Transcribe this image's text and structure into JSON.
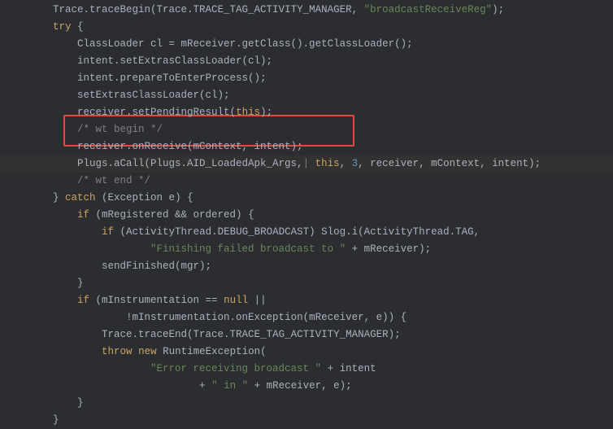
{
  "code": {
    "lines": [
      {
        "indent": "      ",
        "tokens": [
          {
            "t": "Trace.traceBegin(Trace.TRACE_TAG_ACTIVITY_MANAGER, ",
            "c": "ident"
          },
          {
            "t": "\"broadcastReceiveReg\"",
            "c": "str"
          },
          {
            "t": ");",
            "c": "punct"
          }
        ]
      },
      {
        "indent": "      ",
        "tokens": [
          {
            "t": "try",
            "c": "kw"
          },
          {
            "t": " {",
            "c": "punct"
          }
        ]
      },
      {
        "indent": "          ",
        "tokens": [
          {
            "t": "ClassLoader cl = mReceiver.getClass().getClassLoader();",
            "c": "ident"
          }
        ]
      },
      {
        "indent": "          ",
        "tokens": [
          {
            "t": "intent.setExtrasClassLoader(cl);",
            "c": "ident"
          }
        ]
      },
      {
        "indent": "          ",
        "tokens": [
          {
            "t": "intent.prepareToEnterProcess();",
            "c": "ident"
          }
        ]
      },
      {
        "indent": "          ",
        "tokens": [
          {
            "t": "setExtrasClassLoader(cl);",
            "c": "ident"
          }
        ]
      },
      {
        "indent": "          ",
        "tokens": [
          {
            "t": "receiver.setPendingResult(",
            "c": "ident"
          },
          {
            "t": "this",
            "c": "kw"
          },
          {
            "t": ");",
            "c": "punct"
          }
        ]
      },
      {
        "indent": "          ",
        "tokens": [
          {
            "t": "/* wt begin */",
            "c": "comment"
          }
        ]
      },
      {
        "indent": "          ",
        "tokens": [
          {
            "t": "receiver.onReceive(mContext, intent);",
            "c": "ident"
          }
        ]
      },
      {
        "indent": "          ",
        "tokens": [
          {
            "t": "Plugs.aCall(Plugs.AID_LoadedApk_Args,",
            "c": "ident"
          },
          {
            "t": "|",
            "c": "comment"
          },
          {
            "t": " ",
            "c": "ident"
          },
          {
            "t": "this",
            "c": "kw"
          },
          {
            "t": ", ",
            "c": "punct"
          },
          {
            "t": "3",
            "c": "num"
          },
          {
            "t": ", receiver, mContext, intent);",
            "c": "ident"
          }
        ]
      },
      {
        "indent": "          ",
        "tokens": [
          {
            "t": "/* wt end */",
            "c": "comment"
          }
        ]
      },
      {
        "indent": "      ",
        "tokens": [
          {
            "t": "} ",
            "c": "punct"
          },
          {
            "t": "catch",
            "c": "kw"
          },
          {
            "t": " (Exception e) {",
            "c": "ident"
          }
        ]
      },
      {
        "indent": "          ",
        "tokens": [
          {
            "t": "if",
            "c": "kw"
          },
          {
            "t": " (mRegistered && ordered) {",
            "c": "ident"
          }
        ]
      },
      {
        "indent": "              ",
        "tokens": [
          {
            "t": "if",
            "c": "kw"
          },
          {
            "t": " (ActivityThread.DEBUG_BROADCAST) Slog.i(ActivityThread.TAG,",
            "c": "ident"
          }
        ]
      },
      {
        "indent": "                      ",
        "tokens": [
          {
            "t": "\"Finishing failed broadcast to \"",
            "c": "str"
          },
          {
            "t": " + mReceiver);",
            "c": "ident"
          }
        ]
      },
      {
        "indent": "              ",
        "tokens": [
          {
            "t": "sendFinished(mgr);",
            "c": "ident"
          }
        ]
      },
      {
        "indent": "          ",
        "tokens": [
          {
            "t": "}",
            "c": "punct"
          }
        ]
      },
      {
        "indent": "          ",
        "tokens": [
          {
            "t": "if",
            "c": "kw"
          },
          {
            "t": " (mInstrumentation == ",
            "c": "ident"
          },
          {
            "t": "null",
            "c": "kw"
          },
          {
            "t": " ||",
            "c": "ident"
          }
        ]
      },
      {
        "indent": "                  ",
        "tokens": [
          {
            "t": "!mInstrumentation.onException(mReceiver, e)) {",
            "c": "ident"
          }
        ]
      },
      {
        "indent": "              ",
        "tokens": [
          {
            "t": "Trace.traceEnd(Trace.TRACE_TAG_ACTIVITY_MANAGER);",
            "c": "ident"
          }
        ]
      },
      {
        "indent": "              ",
        "tokens": [
          {
            "t": "throw",
            "c": "kw"
          },
          {
            "t": " ",
            "c": "punct"
          },
          {
            "t": "new",
            "c": "kw"
          },
          {
            "t": " RuntimeException(",
            "c": "ident"
          }
        ]
      },
      {
        "indent": "                      ",
        "tokens": [
          {
            "t": "\"Error receiving broadcast \"",
            "c": "str"
          },
          {
            "t": " + intent",
            "c": "ident"
          }
        ]
      },
      {
        "indent": "                              ",
        "tokens": [
          {
            "t": "+ ",
            "c": "ident"
          },
          {
            "t": "\" in \"",
            "c": "str"
          },
          {
            "t": " + mReceiver, e);",
            "c": "ident"
          }
        ]
      },
      {
        "indent": "          ",
        "tokens": [
          {
            "t": "}",
            "c": "punct"
          }
        ]
      },
      {
        "indent": "      ",
        "tokens": [
          {
            "t": "}",
            "c": "punct"
          }
        ]
      }
    ]
  },
  "annotation": {
    "highlighted_line_index": 9,
    "boxed_lines": [
      7,
      8
    ]
  }
}
